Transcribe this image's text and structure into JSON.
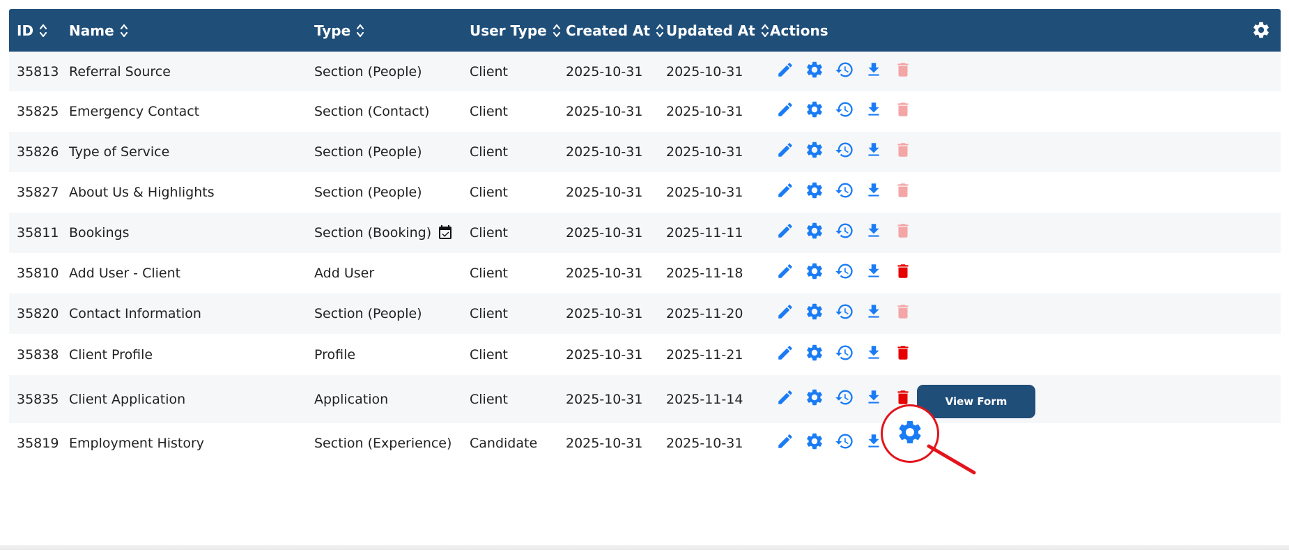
{
  "colors": {
    "header_bg": "#1f4e79",
    "action_blue": "#1a7cf5",
    "delete_active": "#e60000",
    "delete_disabled": "#f4a6a6",
    "annotation_red": "#e3141c"
  },
  "table": {
    "columns": [
      {
        "key": "id",
        "label": "ID",
        "sortable": true
      },
      {
        "key": "name",
        "label": "Name",
        "sortable": true
      },
      {
        "key": "type",
        "label": "Type",
        "sortable": true
      },
      {
        "key": "user_type",
        "label": "User Type",
        "sortable": true
      },
      {
        "key": "created_at",
        "label": "Created At",
        "sortable": true
      },
      {
        "key": "updated_at",
        "label": "Updated At",
        "sortable": true
      },
      {
        "key": "actions",
        "label": "Actions",
        "sortable": false
      }
    ],
    "header_settings_icon": "gear-icon",
    "rows": [
      {
        "id": "35813",
        "name": "Referral Source",
        "type": "Section (People)",
        "user_type": "Client",
        "created_at": "2025-10-31",
        "updated_at": "2025-10-31",
        "delete_enabled": false,
        "calendar_icon": false
      },
      {
        "id": "35825",
        "name": "Emergency Contact",
        "type": "Section (Contact)",
        "user_type": "Client",
        "created_at": "2025-10-31",
        "updated_at": "2025-10-31",
        "delete_enabled": false,
        "calendar_icon": false
      },
      {
        "id": "35826",
        "name": "Type of Service",
        "type": "Section (People)",
        "user_type": "Client",
        "created_at": "2025-10-31",
        "updated_at": "2025-10-31",
        "delete_enabled": false,
        "calendar_icon": false
      },
      {
        "id": "35827",
        "name": "About Us & Highlights",
        "type": "Section (People)",
        "user_type": "Client",
        "created_at": "2025-10-31",
        "updated_at": "2025-10-31",
        "delete_enabled": false,
        "calendar_icon": false
      },
      {
        "id": "35811",
        "name": "Bookings",
        "type": "Section (Booking)",
        "user_type": "Client",
        "created_at": "2025-10-31",
        "updated_at": "2025-11-11",
        "delete_enabled": false,
        "calendar_icon": true
      },
      {
        "id": "35810",
        "name": "Add User - Client",
        "type": "Add User",
        "user_type": "Client",
        "created_at": "2025-10-31",
        "updated_at": "2025-11-18",
        "delete_enabled": true,
        "calendar_icon": false
      },
      {
        "id": "35820",
        "name": "Contact Information",
        "type": "Section (People)",
        "user_type": "Client",
        "created_at": "2025-10-31",
        "updated_at": "2025-11-20",
        "delete_enabled": false,
        "calendar_icon": false
      },
      {
        "id": "35838",
        "name": "Client Profile",
        "type": "Profile",
        "user_type": "Client",
        "created_at": "2025-10-31",
        "updated_at": "2025-11-21",
        "delete_enabled": true,
        "calendar_icon": false
      },
      {
        "id": "35835",
        "name": "Client Application",
        "type": "Application",
        "user_type": "Client",
        "created_at": "2025-10-31",
        "updated_at": "2025-11-14",
        "delete_enabled": true,
        "calendar_icon": false,
        "view_button": "View Form"
      },
      {
        "id": "35819",
        "name": "Employment History",
        "type": "Section (Experience)",
        "user_type": "Candidate",
        "created_at": "2025-10-31",
        "updated_at": "2025-10-31",
        "delete_enabled": false,
        "calendar_icon": false
      }
    ],
    "action_icons": [
      "pencil-icon",
      "gear-icon",
      "history-icon",
      "download-icon",
      "trash-icon"
    ]
  },
  "annotation": {
    "icon": "gear-icon"
  }
}
